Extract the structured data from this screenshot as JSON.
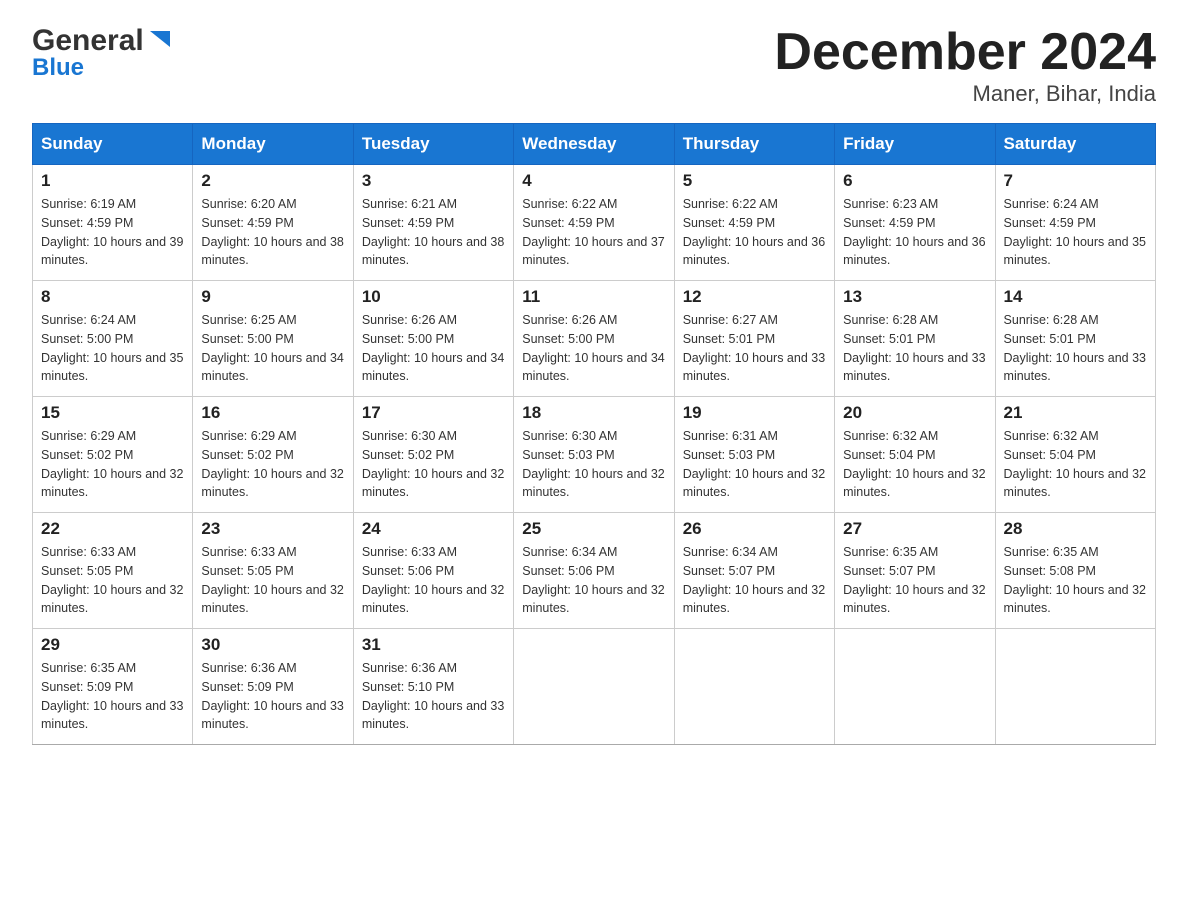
{
  "header": {
    "logo_general": "General",
    "logo_blue": "Blue",
    "title": "December 2024",
    "subtitle": "Maner, Bihar, India"
  },
  "days_of_week": [
    "Sunday",
    "Monday",
    "Tuesday",
    "Wednesday",
    "Thursday",
    "Friday",
    "Saturday"
  ],
  "weeks": [
    [
      {
        "day": 1,
        "sunrise": "6:19 AM",
        "sunset": "4:59 PM",
        "daylight": "10 hours and 39 minutes."
      },
      {
        "day": 2,
        "sunrise": "6:20 AM",
        "sunset": "4:59 PM",
        "daylight": "10 hours and 38 minutes."
      },
      {
        "day": 3,
        "sunrise": "6:21 AM",
        "sunset": "4:59 PM",
        "daylight": "10 hours and 38 minutes."
      },
      {
        "day": 4,
        "sunrise": "6:22 AM",
        "sunset": "4:59 PM",
        "daylight": "10 hours and 37 minutes."
      },
      {
        "day": 5,
        "sunrise": "6:22 AM",
        "sunset": "4:59 PM",
        "daylight": "10 hours and 36 minutes."
      },
      {
        "day": 6,
        "sunrise": "6:23 AM",
        "sunset": "4:59 PM",
        "daylight": "10 hours and 36 minutes."
      },
      {
        "day": 7,
        "sunrise": "6:24 AM",
        "sunset": "4:59 PM",
        "daylight": "10 hours and 35 minutes."
      }
    ],
    [
      {
        "day": 8,
        "sunrise": "6:24 AM",
        "sunset": "5:00 PM",
        "daylight": "10 hours and 35 minutes."
      },
      {
        "day": 9,
        "sunrise": "6:25 AM",
        "sunset": "5:00 PM",
        "daylight": "10 hours and 34 minutes."
      },
      {
        "day": 10,
        "sunrise": "6:26 AM",
        "sunset": "5:00 PM",
        "daylight": "10 hours and 34 minutes."
      },
      {
        "day": 11,
        "sunrise": "6:26 AM",
        "sunset": "5:00 PM",
        "daylight": "10 hours and 34 minutes."
      },
      {
        "day": 12,
        "sunrise": "6:27 AM",
        "sunset": "5:01 PM",
        "daylight": "10 hours and 33 minutes."
      },
      {
        "day": 13,
        "sunrise": "6:28 AM",
        "sunset": "5:01 PM",
        "daylight": "10 hours and 33 minutes."
      },
      {
        "day": 14,
        "sunrise": "6:28 AM",
        "sunset": "5:01 PM",
        "daylight": "10 hours and 33 minutes."
      }
    ],
    [
      {
        "day": 15,
        "sunrise": "6:29 AM",
        "sunset": "5:02 PM",
        "daylight": "10 hours and 32 minutes."
      },
      {
        "day": 16,
        "sunrise": "6:29 AM",
        "sunset": "5:02 PM",
        "daylight": "10 hours and 32 minutes."
      },
      {
        "day": 17,
        "sunrise": "6:30 AM",
        "sunset": "5:02 PM",
        "daylight": "10 hours and 32 minutes."
      },
      {
        "day": 18,
        "sunrise": "6:30 AM",
        "sunset": "5:03 PM",
        "daylight": "10 hours and 32 minutes."
      },
      {
        "day": 19,
        "sunrise": "6:31 AM",
        "sunset": "5:03 PM",
        "daylight": "10 hours and 32 minutes."
      },
      {
        "day": 20,
        "sunrise": "6:32 AM",
        "sunset": "5:04 PM",
        "daylight": "10 hours and 32 minutes."
      },
      {
        "day": 21,
        "sunrise": "6:32 AM",
        "sunset": "5:04 PM",
        "daylight": "10 hours and 32 minutes."
      }
    ],
    [
      {
        "day": 22,
        "sunrise": "6:33 AM",
        "sunset": "5:05 PM",
        "daylight": "10 hours and 32 minutes."
      },
      {
        "day": 23,
        "sunrise": "6:33 AM",
        "sunset": "5:05 PM",
        "daylight": "10 hours and 32 minutes."
      },
      {
        "day": 24,
        "sunrise": "6:33 AM",
        "sunset": "5:06 PM",
        "daylight": "10 hours and 32 minutes."
      },
      {
        "day": 25,
        "sunrise": "6:34 AM",
        "sunset": "5:06 PM",
        "daylight": "10 hours and 32 minutes."
      },
      {
        "day": 26,
        "sunrise": "6:34 AM",
        "sunset": "5:07 PM",
        "daylight": "10 hours and 32 minutes."
      },
      {
        "day": 27,
        "sunrise": "6:35 AM",
        "sunset": "5:07 PM",
        "daylight": "10 hours and 32 minutes."
      },
      {
        "day": 28,
        "sunrise": "6:35 AM",
        "sunset": "5:08 PM",
        "daylight": "10 hours and 32 minutes."
      }
    ],
    [
      {
        "day": 29,
        "sunrise": "6:35 AM",
        "sunset": "5:09 PM",
        "daylight": "10 hours and 33 minutes."
      },
      {
        "day": 30,
        "sunrise": "6:36 AM",
        "sunset": "5:09 PM",
        "daylight": "10 hours and 33 minutes."
      },
      {
        "day": 31,
        "sunrise": "6:36 AM",
        "sunset": "5:10 PM",
        "daylight": "10 hours and 33 minutes."
      },
      null,
      null,
      null,
      null
    ]
  ]
}
